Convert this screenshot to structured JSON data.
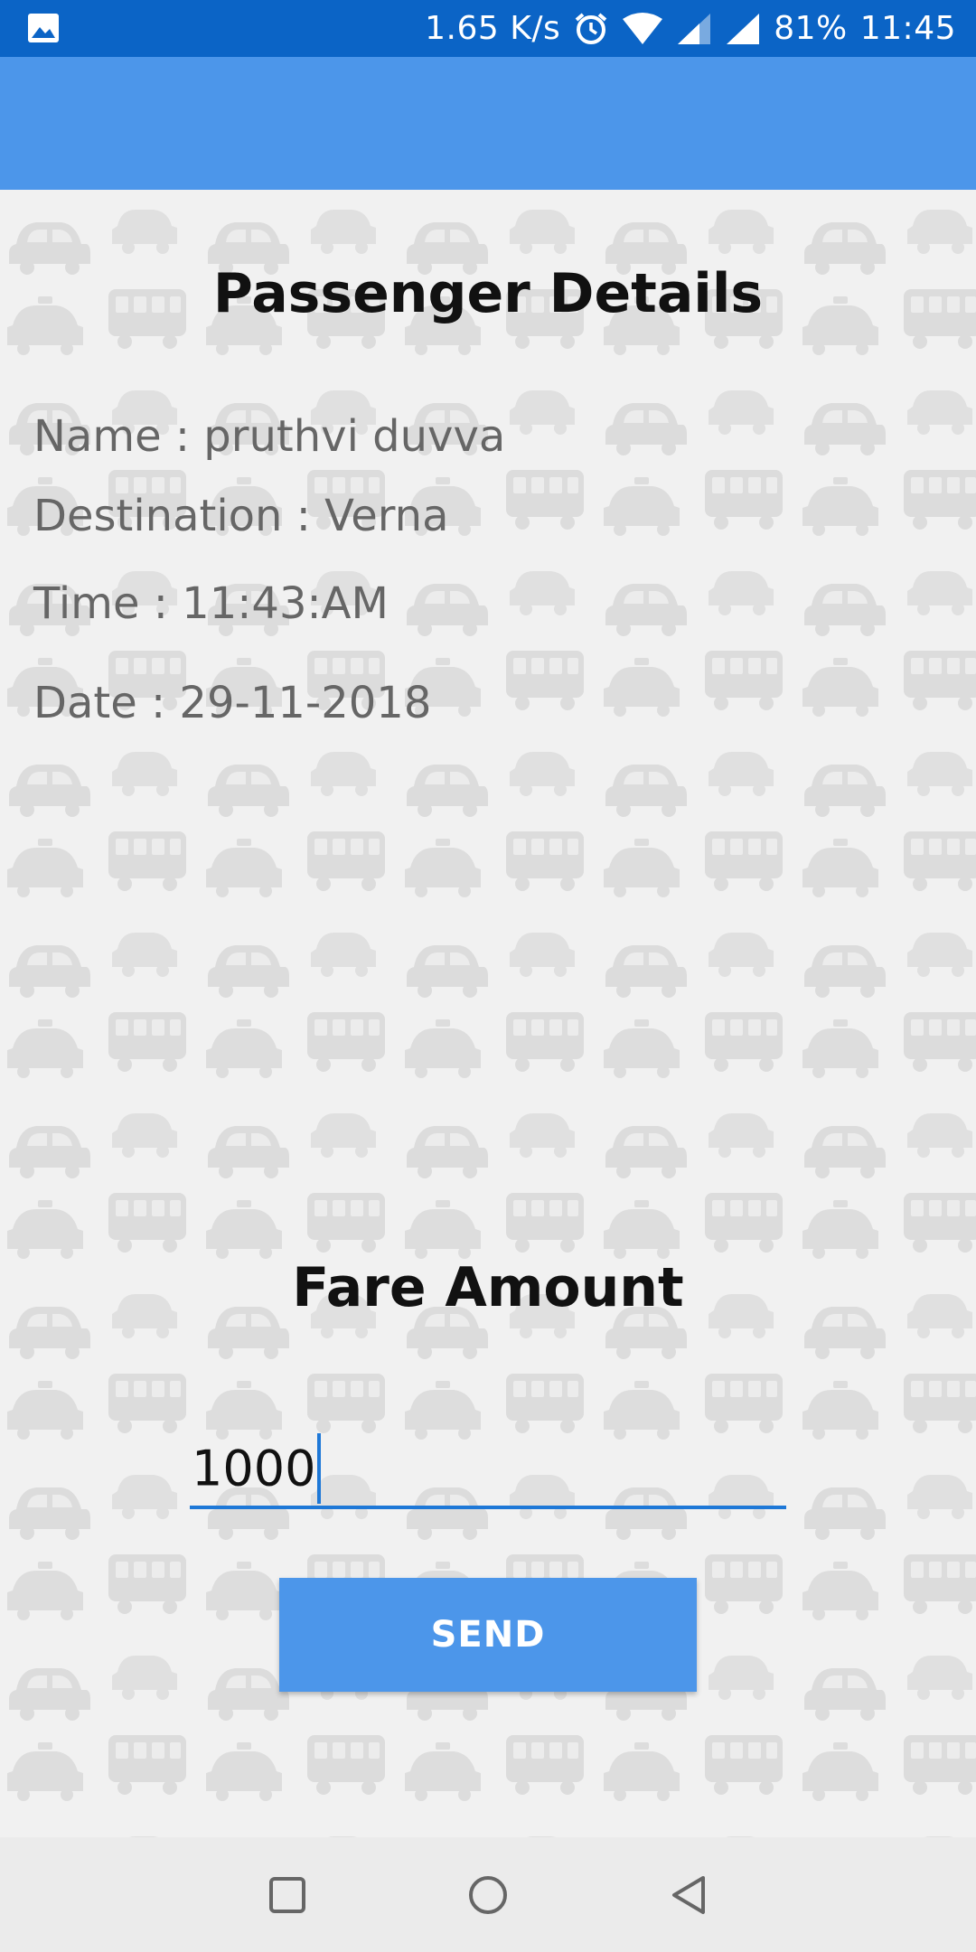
{
  "status_bar": {
    "network_speed": "1.65 K/s",
    "battery": "81%",
    "time": "11:45",
    "icons": [
      "gallery-icon",
      "alarm-icon",
      "wifi-icon",
      "signal-icon",
      "signal-icon"
    ]
  },
  "passenger": {
    "heading": "Passenger Details",
    "name_label": "Name",
    "name_value": "pruthvi duvva",
    "destination_label": "Destination",
    "destination_value": "Verna",
    "time_label": "Time",
    "time_value": "11:43:AM",
    "date_label": "Date",
    "date_value": "29-11-2018",
    "separator": " : "
  },
  "fare": {
    "heading": "Fare Amount",
    "input_value": "1000",
    "send_label": "SEND"
  },
  "colors": {
    "status_bar": "#0b64c6",
    "app_bar": "#4c96ea",
    "button": "#4c96ea",
    "input_underline": "#1e78d7"
  },
  "nav_bar": {
    "icons": [
      "recent-apps-icon",
      "home-icon",
      "back-icon"
    ]
  }
}
